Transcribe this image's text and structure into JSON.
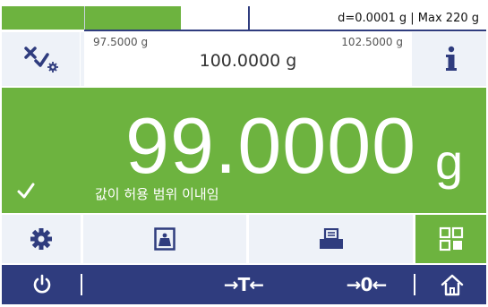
{
  "capacity": {
    "fill_fraction": 0.37,
    "info_text": "d=0.0001 g | Max 220 g"
  },
  "tolerance": {
    "lower": "97.5000 g",
    "target": "100.0000 g",
    "upper": "102.5000 g"
  },
  "weight": {
    "value": "99.0000",
    "unit": "g",
    "status": "값이 허용 범위 이내임"
  },
  "colors": {
    "green": "#6db33f",
    "navy": "#2f3c7e",
    "light": "#eef2f8"
  },
  "icons": {
    "tolerance_settings": "tolerance-settings-icon",
    "info": "info-icon",
    "check": "check-icon",
    "settings": "gear-icon",
    "weight": "weight-icon",
    "print": "printer-icon",
    "apps": "apps-grid-icon",
    "power": "power-icon",
    "tare": "tare-icon",
    "zero": "zero-icon",
    "home": "home-icon"
  },
  "nav": {
    "tare_label": "→T←",
    "zero_label": "→0←"
  }
}
